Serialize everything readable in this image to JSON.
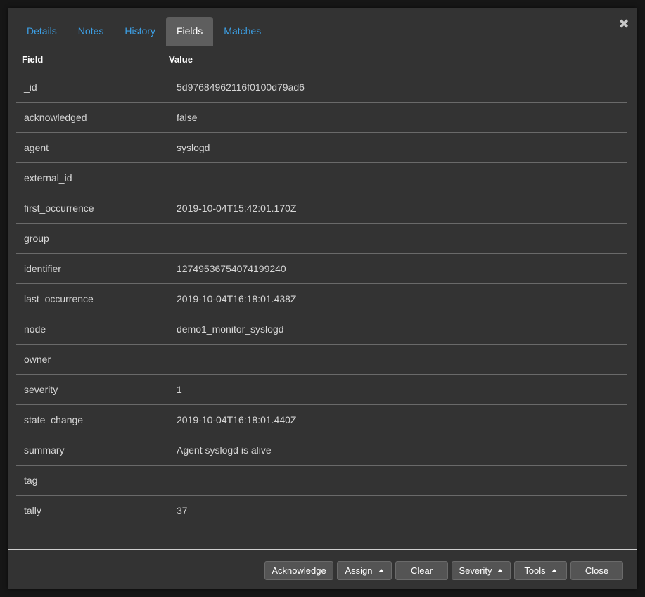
{
  "dialog": {
    "close_glyph": "✖"
  },
  "tabs": [
    {
      "label": "Details",
      "active": false
    },
    {
      "label": "Notes",
      "active": false
    },
    {
      "label": "History",
      "active": false
    },
    {
      "label": "Fields",
      "active": true
    },
    {
      "label": "Matches",
      "active": false
    }
  ],
  "table": {
    "headers": {
      "field": "Field",
      "value": "Value"
    },
    "rows": [
      {
        "field": "_id",
        "value": "5d97684962116f0100d79ad6"
      },
      {
        "field": "acknowledged",
        "value": "false"
      },
      {
        "field": "agent",
        "value": "syslogd"
      },
      {
        "field": "external_id",
        "value": ""
      },
      {
        "field": "first_occurrence",
        "value": "2019-10-04T15:42:01.170Z"
      },
      {
        "field": "group",
        "value": ""
      },
      {
        "field": "identifier",
        "value": "12749536754074199240"
      },
      {
        "field": "last_occurrence",
        "value": "2019-10-04T16:18:01.438Z"
      },
      {
        "field": "node",
        "value": "demo1_monitor_syslogd"
      },
      {
        "field": "owner",
        "value": ""
      },
      {
        "field": "severity",
        "value": "1"
      },
      {
        "field": "state_change",
        "value": "2019-10-04T16:18:01.440Z"
      },
      {
        "field": "summary",
        "value": "Agent syslogd is alive"
      },
      {
        "field": "tag",
        "value": ""
      },
      {
        "field": "tally",
        "value": "37"
      }
    ]
  },
  "footer": {
    "acknowledge_label": "Acknowledge",
    "assign_label": "Assign",
    "clear_label": "Clear",
    "severity_label": "Severity",
    "tools_label": "Tools",
    "close_label": "Close"
  },
  "colors": {
    "background": "#161616",
    "panel": "#333333",
    "tab_link": "#3ca0e6",
    "tab_active_bg": "#5e5e5e",
    "button_bg": "#545454"
  }
}
